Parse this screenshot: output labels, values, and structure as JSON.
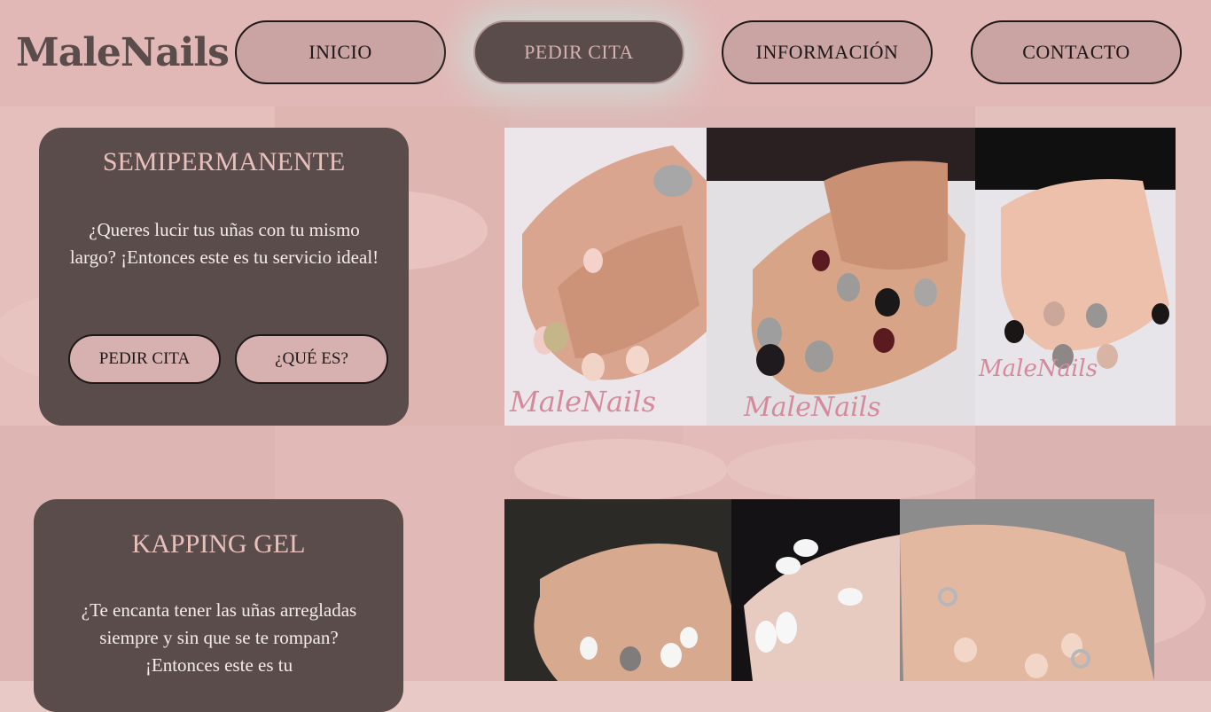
{
  "logo": "MaleNails",
  "nav": [
    {
      "label": "INICIO",
      "active": false
    },
    {
      "label": "PEDIR CITA",
      "active": true
    },
    {
      "label": "INFORMACIÓN",
      "active": false
    },
    {
      "label": "CONTACTO",
      "active": false
    }
  ],
  "services": [
    {
      "title": "SEMIPERMANENTE",
      "description": "¿Queres lucir tus uñas con tu mismo largo? ¡Entonces este es tu servicio ideal!",
      "book_label": "PEDIR CITA",
      "info_label": "¿QUÉ ES?"
    },
    {
      "title": "KAPPING GEL",
      "description": "¿Te encanta tener las uñas arregladas siempre y sin que se te rompan? ¡Entonces este es tu"
    }
  ],
  "photos": {
    "watermark": "MaleNails"
  },
  "colors": {
    "header": "#e2b8b6",
    "card": "#5b4c4c",
    "title": "#e8c0bc",
    "button": "#c9a4a3",
    "button_active": "#5b4c4c"
  }
}
